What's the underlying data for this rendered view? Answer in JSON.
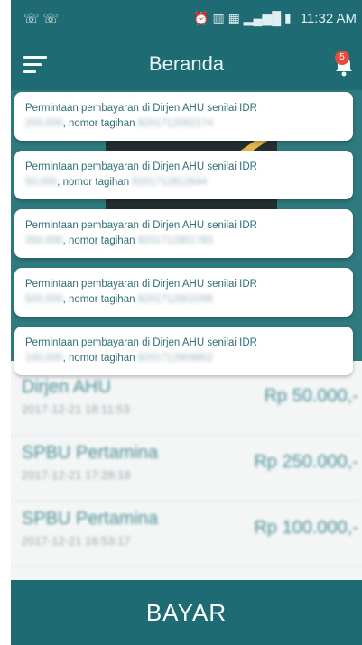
{
  "statusbar": {
    "left_icons": "☏☏",
    "time": "11:32 AM",
    "icons": "⏰ ▥ ▦ ▂▄▆█ ▮"
  },
  "appbar": {
    "title": "Beranda",
    "badge": "5"
  },
  "notifications": [
    {
      "line1": "Permintaan pembayaran di Dirjen AHU senilai IDR",
      "amount_blurred": "250,000",
      "tail": ", nomor tagihan",
      "invoice_blurred": "8201712082174"
    },
    {
      "line1": "Permintaan pembayaran di Dirjen AHU senilai IDR",
      "amount_blurred": "50,000",
      "tail": ", nomor tagihan",
      "invoice_blurred": "8201712812644"
    },
    {
      "line1": "Permintaan pembayaran di Dirjen AHU senilai IDR",
      "amount_blurred": "250,000",
      "tail": ", nomor tagihan",
      "invoice_blurred": "8201712801783"
    },
    {
      "line1": "Permintaan pembayaran di Dirjen AHU senilai IDR",
      "amount_blurred": "500,000",
      "tail": ", nomor tagihan",
      "invoice_blurred": "8201712801096"
    },
    {
      "line1": "Permintaan pembayaran di Dirjen AHU senilai IDR",
      "amount_blurred": "100,000",
      "tail": ", nomor tagihan",
      "invoice_blurred": "8201712809852"
    }
  ],
  "transactions": [
    {
      "name": "Dirjen AHU",
      "date": "2017-12-21 18:11:53",
      "amount": "Rp 50.000,-"
    },
    {
      "name": "SPBU Pertamina",
      "date": "2017-12-21 17:28:18",
      "amount": "Rp 250.000,-"
    },
    {
      "name": "SPBU Pertamina",
      "date": "2017-12-21 16:53:17",
      "amount": "Rp 100.000,-"
    }
  ],
  "bottom": {
    "pay_label": "BAYAR"
  }
}
